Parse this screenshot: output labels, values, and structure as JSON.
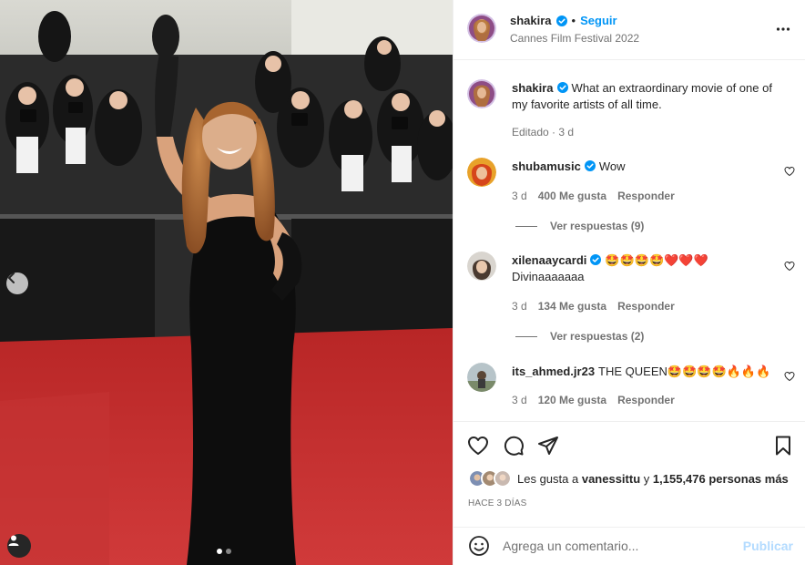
{
  "post": {
    "author": "shakira",
    "follow_label": "Seguir",
    "separator": "•",
    "location": "Cannes Film Festival 2022",
    "caption": "What an extraordinary movie of one of my favorite artists of all time.",
    "caption_meta": "Editado · 3 d"
  },
  "comments": [
    {
      "user": "shubamusic",
      "text": "Wow",
      "time": "3 d",
      "likes": "400 Me gusta",
      "reply": "Responder",
      "view_replies": "Ver respuestas (9)"
    },
    {
      "user": "xilenaaycardi",
      "text": "🤩🤩🤩🤩❤️❤️❤️",
      "text2": "Divinaaaaaaa",
      "time": "3 d",
      "likes": "134 Me gusta",
      "reply": "Responder",
      "view_replies": "Ver respuestas (2)"
    },
    {
      "user": "its_ahmed.jr23",
      "text": "THE QUEEN🤩🤩🤩🤩🔥🔥🔥",
      "time": "3 d",
      "likes": "120 Me gusta",
      "reply": "Responder"
    }
  ],
  "likes": {
    "prefix": "Les gusta a",
    "user": "vanessittu",
    "middle": "y",
    "count": "1,155,476 personas más"
  },
  "posted_ago": "HACE 3 DÍAS",
  "compose": {
    "placeholder": "Agrega un comentario...",
    "publish_label": "Publicar"
  },
  "carousel": {
    "slides": 2,
    "active_slide": 1
  },
  "icons": {
    "header": [
      "verified-badge-icon",
      "more-options-icon"
    ],
    "actions": [
      "heart-icon",
      "comment-icon",
      "share-icon",
      "bookmark-icon"
    ],
    "photo": [
      "chevron-left-icon",
      "user-tag-icon"
    ],
    "compose": [
      "emoji-icon"
    ]
  },
  "colors": {
    "accent": "#0095f6",
    "publish_disabled": "#b3dbff",
    "carpet": "#c62f2f",
    "text": "#262626",
    "muted": "#737373"
  }
}
